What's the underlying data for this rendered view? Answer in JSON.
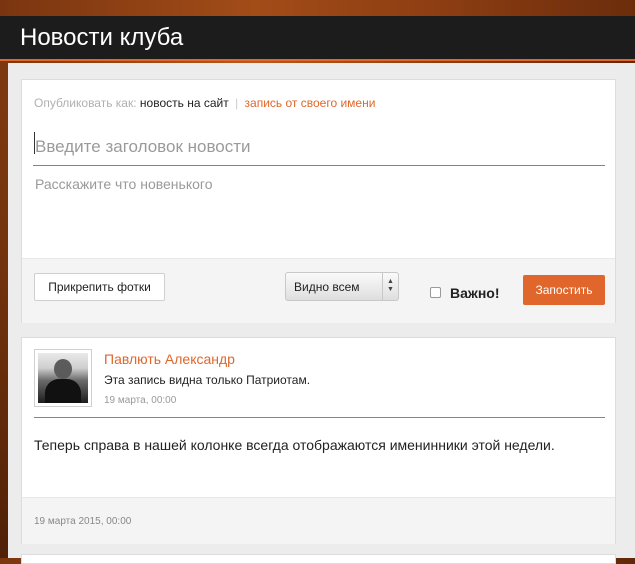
{
  "page": {
    "title": "Новости клуба"
  },
  "composer": {
    "publish_as_label": "Опубликовать как:",
    "publish_as_options": [
      "новость на сайт",
      "запись от своего имени"
    ],
    "separator": "|",
    "title_placeholder": "Введите заголовок новости",
    "body_placeholder": "Расскажите что новенького",
    "attach_photos_label": "Прикрепить фотки",
    "visibility_selected": "Видно всем",
    "important_label": "Важно!",
    "important_checked": false,
    "submit_label": "Запостить"
  },
  "posts": [
    {
      "author": "Павлють Александр",
      "visibility_note": "Эта запись видна только Патриотам.",
      "date_short": "19 марта, 00:00",
      "text": "Теперь справа в нашей колонке всегда отображаются именинники этой недели.",
      "date_full": "19 марта 2015, 00:00"
    }
  ],
  "colors": {
    "accent": "#e0662b",
    "header_bg": "#1c1c1c"
  }
}
